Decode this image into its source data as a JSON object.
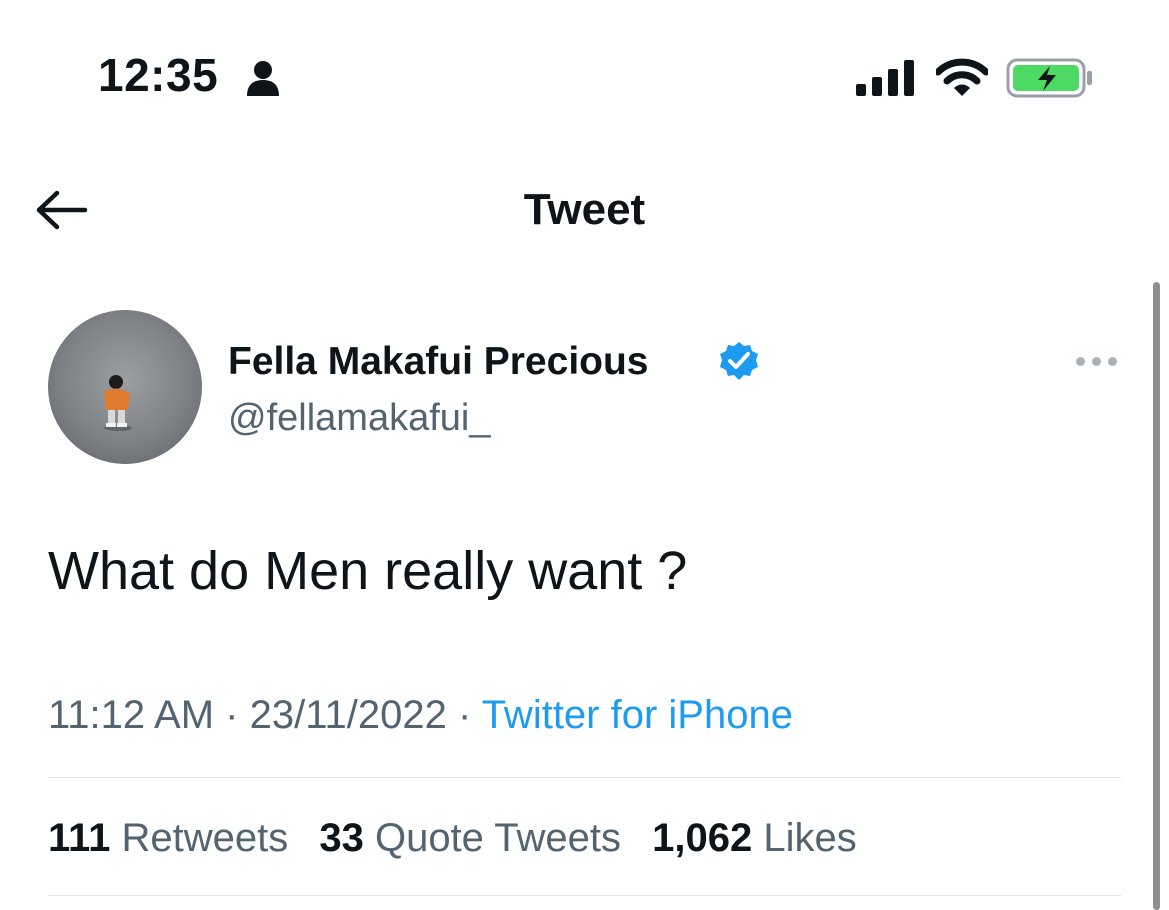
{
  "status_bar": {
    "time": "12:35",
    "icons": [
      "person-icon",
      "signal-icon",
      "wifi-icon",
      "battery-charging-icon"
    ],
    "battery_color": "#4cd964"
  },
  "header": {
    "title": "Tweet",
    "back_icon": "arrow-left-icon"
  },
  "tweet": {
    "author_name": "Fella Makafui Precious",
    "verified": true,
    "verified_color": "#1d9bf0",
    "handle": "@fellamakafui_",
    "more_icon": "more-horizontal-icon",
    "text": "What do Men really want ?",
    "time": "11:12 AM",
    "date": "23/11/2022",
    "separator": "·",
    "source": "Twitter for iPhone",
    "source_color": "#1d9bf0"
  },
  "stats": {
    "retweets_count": "111",
    "retweets_label": "Retweets",
    "quotes_count": "33",
    "quotes_label": "Quote Tweets",
    "likes_count": "1,062",
    "likes_label": "Likes"
  },
  "colors": {
    "primary_text": "#0f1419",
    "secondary_text": "#536471",
    "accent": "#1d9bf0"
  }
}
